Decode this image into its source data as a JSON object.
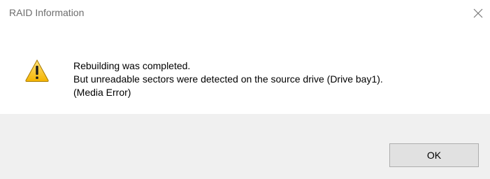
{
  "window": {
    "title": "RAID Information",
    "close_icon": "close-icon"
  },
  "message": {
    "icon": "warning-icon",
    "lines": [
      "Rebuilding was completed.",
      "But unreadable sectors were detected on the source drive (Drive bay1).",
      "(Media Error)"
    ]
  },
  "buttons": {
    "ok_label": "OK"
  },
  "colors": {
    "footer_bg": "#f0f0f0",
    "button_bg": "#e1e1e1",
    "button_border": "#adadad",
    "title_text": "#6d6d6d"
  }
}
